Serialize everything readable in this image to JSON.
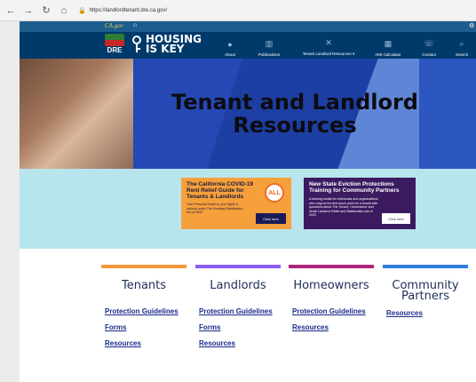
{
  "browser": {
    "nav": [
      "←",
      "→",
      "↻",
      "⌂"
    ],
    "url": "https://landlordtenant.dre.ca.gov/"
  },
  "topstrip": {
    "ca_label": "CA.gov"
  },
  "header": {
    "dre_label": "DRE",
    "brand_line1": "HOUSING",
    "brand_line2": "IS KEY",
    "nav_items": [
      {
        "label": "About",
        "icon": "chat-icon"
      },
      {
        "label": "Publications",
        "icon": "book-icon"
      },
      {
        "label": "Tenant Landlord Resources ▾",
        "icon": "tools-icon"
      },
      {
        "label": "AMI Calculator",
        "icon": "calculator-icon"
      },
      {
        "label": "Contact",
        "icon": "phone-icon"
      },
      {
        "label": "Search",
        "icon": "search-icon"
      }
    ]
  },
  "hero": {
    "title": "Tenant and Landlord Resources"
  },
  "promo": {
    "card1": {
      "title": "The California COVID-19 Rent Relief Guide for Tenants & Landlords",
      "subtitle": "Your Personal Guide to your rights & options under The Housing Stabilization Act of 2020",
      "badge": "ALL",
      "button": "Click here"
    },
    "card2": {
      "title": "New State Eviction Protections Training for Community Partners",
      "subtitle": "A training toolkit for individuals and organizations who may be the first touch point for a tenant with questions about The Tenant, Homeowner and Small Landlord Relief and Stabilization Act of 2020",
      "button": "Click here"
    }
  },
  "columns": [
    {
      "heading": "Tenants",
      "color": "#f59a3b",
      "links": [
        "Protection Guidelines",
        "Forms",
        "Resources"
      ]
    },
    {
      "heading": "Landlords",
      "color": "#8b5cf6",
      "links": [
        "Protection Guidelines",
        "Forms",
        "Resources"
      ]
    },
    {
      "heading": "Homeowners",
      "color": "#b0257c",
      "links": [
        "Protection Guidelines",
        "Resources"
      ]
    },
    {
      "heading": "Community Partners",
      "color": "#2f7fe0",
      "links": [
        "Resources"
      ]
    }
  ]
}
